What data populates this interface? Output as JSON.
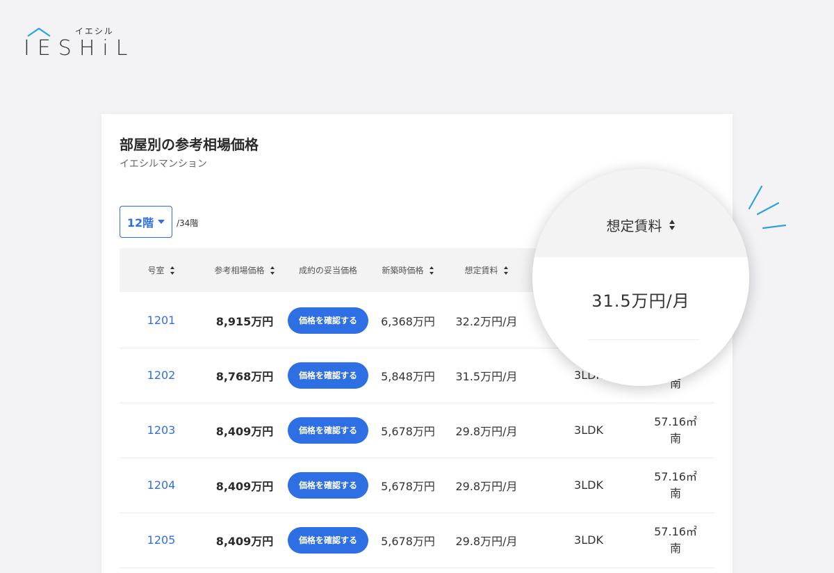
{
  "logo": {
    "kana": "イエシル",
    "word": "IESHiL"
  },
  "card": {
    "title": "部屋別の参考相場価格",
    "subtitle": "イエシルマンション"
  },
  "floor": {
    "selected": "12階",
    "total": "/34階"
  },
  "table": {
    "headers": {
      "room": "号室",
      "reference_price": "参考相場価格",
      "fair_price": "成約の妥当価格",
      "new_price": "新築時価格",
      "rent": "想定賃料"
    },
    "button_label": "価格を確認する",
    "rows": [
      {
        "room": "1201",
        "reference_price": "8,915万円",
        "new_price": "6,368万円",
        "rent": "32.2万円/月",
        "layout": "",
        "area": "",
        "direction": ""
      },
      {
        "room": "1202",
        "reference_price": "8,768万円",
        "new_price": "5,848万円",
        "rent": "31.5万円/月",
        "layout": "3LDK",
        "area": "",
        "direction": "南"
      },
      {
        "room": "1203",
        "reference_price": "8,409万円",
        "new_price": "5,678万円",
        "rent": "29.8万円/月",
        "layout": "3LDK",
        "area": "57.16㎡",
        "direction": "南"
      },
      {
        "room": "1204",
        "reference_price": "8,409万円",
        "new_price": "5,678万円",
        "rent": "29.8万円/月",
        "layout": "3LDK",
        "area": "57.16㎡",
        "direction": "南"
      },
      {
        "room": "1205",
        "reference_price": "8,409万円",
        "new_price": "5,678万円",
        "rent": "29.8万円/月",
        "layout": "3LDK",
        "area": "57.16㎡",
        "direction": "南"
      }
    ]
  },
  "magnifier": {
    "header": "想定賃料",
    "value": "31.5万円/月"
  },
  "colors": {
    "accent": "#2f6fe4",
    "header_bg": "#f3f3f4",
    "page_bg": "#f3f3f6"
  }
}
